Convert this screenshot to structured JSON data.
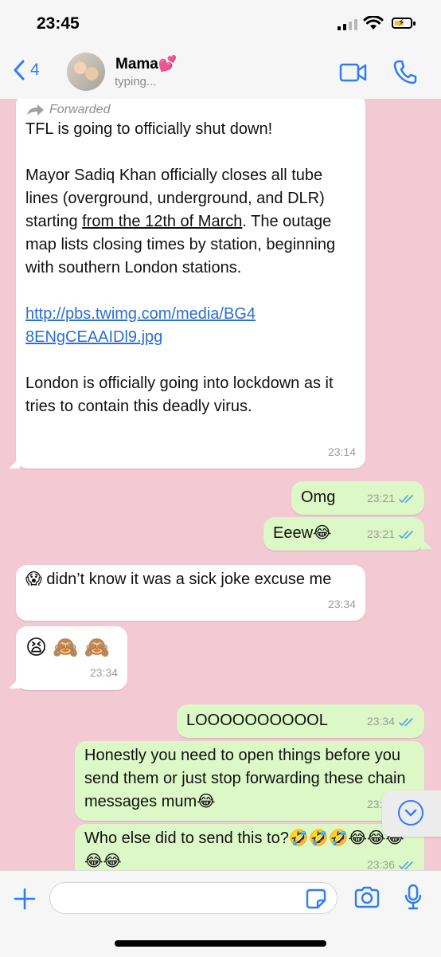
{
  "status_bar": {
    "time": "23:45"
  },
  "header": {
    "back_count": "4",
    "contact_name": "Mama💕",
    "contact_status": "typing..."
  },
  "messages": [
    {
      "direction": "in",
      "forwarded_label": "Forwarded",
      "paragraphs": [
        "TFL is going to officially shut down!",
        "Mayor Sadiq Khan officially closes all tube lines (overground, underground, and DLR)  starting ",
        "from the 12th of March",
        ". The outage map lists closing times by station, beginning with southern London stations.",
        "http://pbs.twimg.com/media/BG48ENgCEAAIDl9.jpg",
        "London is officially going into lockdown as it tries to contain this deadly virus."
      ],
      "time": "23:14"
    },
    {
      "direction": "out",
      "text": "Omg",
      "time": "23:21"
    },
    {
      "direction": "out",
      "text": "Eeew😂",
      "time": "23:21"
    },
    {
      "direction": "in",
      "text": "😱 didn’t know it was a sick joke excuse me",
      "time": "23:34"
    },
    {
      "direction": "in",
      "text": "😫 🙈 🙈",
      "time": "23:34"
    },
    {
      "direction": "out",
      "text": "LOOOOOOOOOOL",
      "time": "23:34"
    },
    {
      "direction": "out",
      "text": "Honestly you need to open things before you send them or just stop forwarding these chain messages mum😂",
      "time": "23:34"
    },
    {
      "direction": "out",
      "text": "Who else did to send this to?🤣🤣🤣😂😂😂😂😂",
      "time": "23:36"
    }
  ],
  "colors": {
    "chat_background": "#f3c9d3",
    "incoming_bubble": "#ffffff",
    "outgoing_bubble": "#dcf8c6",
    "accent": "#2e7cf6",
    "read_ticks": "#4fa3e0"
  },
  "icons": [
    "back-chevron-icon",
    "video-call-icon",
    "phone-call-icon",
    "plus-icon",
    "sticker-icon",
    "camera-icon",
    "microphone-icon",
    "scroll-down-icon",
    "forwarded-arrow-icon",
    "read-receipt-icon"
  ]
}
